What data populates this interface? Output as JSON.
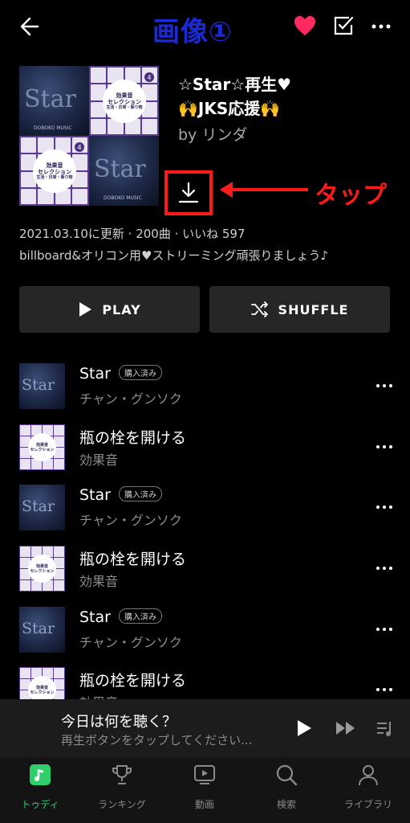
{
  "header": {
    "annotation_title": "画像①"
  },
  "cover": {
    "star_text": "Star",
    "star_caption": "DOBOKO MUSIC",
    "fx_line1": "効果音",
    "fx_line2": "セレクション",
    "fx_line3": "生活・日常・乗り物",
    "fx_number": "4"
  },
  "playlist": {
    "title_line1": "☆Star☆再生♥",
    "title_line2": "🙌JKS応援🙌",
    "by": "by リンダ",
    "tap_label": "タップ",
    "meta": "2021.03.10に更新 · 200曲 · いいね 597",
    "description": "billboard&オリコン用♥ストリーミング頑張りましょう♪"
  },
  "buttons": {
    "play": "PLAY",
    "shuffle": "SHUFFLE"
  },
  "tracks": [
    {
      "title": "Star",
      "artist": "チャン・グンソク",
      "badge": "購入済み",
      "art": "star"
    },
    {
      "title": "瓶の栓を開ける",
      "artist": "効果音",
      "badge": "",
      "art": "fx"
    },
    {
      "title": "Star",
      "artist": "チャン・グンソク",
      "badge": "購入済み",
      "art": "star"
    },
    {
      "title": "瓶の栓を開ける",
      "artist": "効果音",
      "badge": "",
      "art": "fx"
    },
    {
      "title": "Star",
      "artist": "チャン・グンソク",
      "badge": "購入済み",
      "art": "star"
    },
    {
      "title": "瓶の栓を開ける",
      "artist": "効果音",
      "badge": "",
      "art": "fx"
    }
  ],
  "mini_player": {
    "title": "今日は何を聴く？",
    "subtitle": "再生ボタンをタップしてください..."
  },
  "nav": {
    "today": "トゥディ",
    "ranking": "ランキング",
    "video": "動画",
    "search": "検索",
    "library": "ライブラリ"
  },
  "colors": {
    "accent_green": "#2fd06b",
    "heart_red": "#ff2a5f",
    "annotation_red": "#ff1a1a",
    "annotation_blue": "#1a2ad8"
  }
}
